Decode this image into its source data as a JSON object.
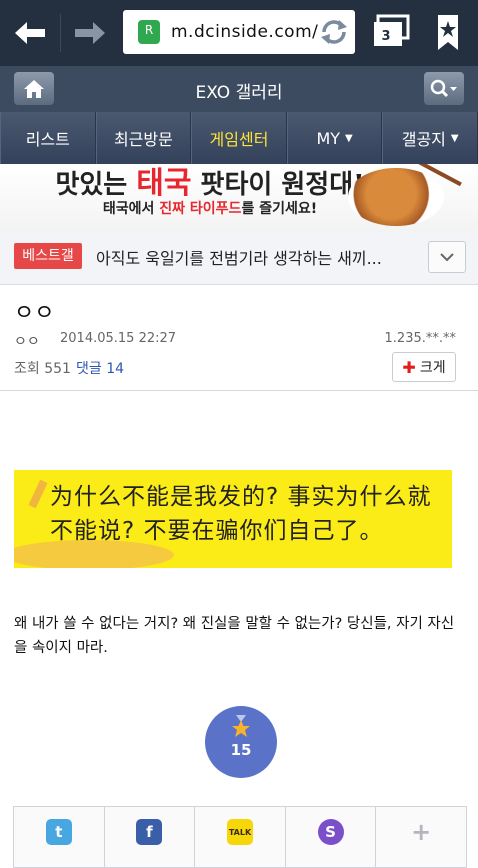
{
  "browser": {
    "url": "m.dcinside.com/",
    "tab_count": "3",
    "site_icon_letter": "R"
  },
  "gallery": {
    "title": "EXO 갤러리"
  },
  "menu": {
    "items": [
      {
        "label": "리스트",
        "caret": ""
      },
      {
        "label": "최근방문",
        "caret": ""
      },
      {
        "label": "게임센터",
        "caret": ""
      },
      {
        "label": "MY",
        "caret": "▼"
      },
      {
        "label": "갤공지",
        "caret": "▼"
      }
    ]
  },
  "banner": {
    "head_prefix": "맛있는 ",
    "head_highlight": "태국",
    "head_suffix": " 팟타이 원정대!",
    "sub_prefix": "태국에서 ",
    "sub_highlight": "진짜 타이푸드",
    "sub_suffix": "를 즐기세요!"
  },
  "best": {
    "badge": "베스트갤",
    "text": "아직도 욱일기를 전범기라 생각하는 새끼..."
  },
  "post": {
    "title": "ㅇㅇ",
    "author": "ㅇㅇ",
    "date": "2014.05.15 22:27",
    "ip": "1.235.**.**",
    "views": "조회 551",
    "comments": "댓글 14",
    "enlarge_label": "크게",
    "image_text": "为什么不能是我发的? 事实为什么就不能说?  不要在骗你们自己了。",
    "body": "왜 내가 쓸 수 없다는 거지? 왜 진실을 말할 수 없는가? 당신들, 자기 자신을 속이지 마라.",
    "recommend_count": "15"
  },
  "share": {
    "items": [
      {
        "icon": "twitter-icon",
        "glyph": "t"
      },
      {
        "icon": "facebook-icon",
        "glyph": "f"
      },
      {
        "icon": "kakaotalk-icon",
        "glyph": "TALK"
      },
      {
        "icon": "kakaostory-icon",
        "glyph": "S"
      },
      {
        "icon": "more-icon",
        "glyph": "+"
      }
    ]
  },
  "colors": {
    "browser_bar": "#24303f",
    "gallery_bar": "#3c4b60",
    "menu_active": "#ffe43a",
    "best_badge": "#e64848",
    "comment_link": "#2e56b7",
    "recommend": "#5a73c9"
  }
}
